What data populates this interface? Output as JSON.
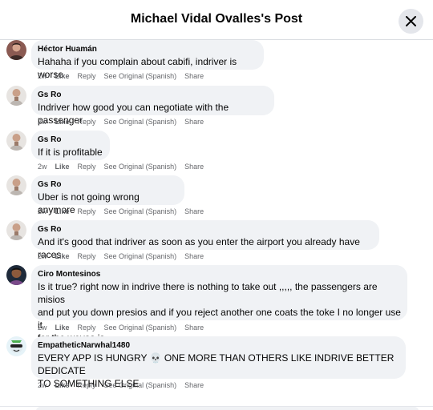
{
  "dialog": {
    "title": "Michael Vidal Ovalles's Post"
  },
  "labels": {
    "like": "Like",
    "reply": "Reply",
    "see_original": "See Original (Spanish)",
    "share": "Share"
  },
  "comments": [
    {
      "author": "Héctor Huamán",
      "text": "Hahaha if you complain about cabifi, indriver is worse",
      "time": "2w"
    },
    {
      "author": "Gs Ro",
      "text": "Indriver how good you can negotiate with the passenger",
      "time": "2w"
    },
    {
      "author": "Gs Ro",
      "text": "If it is profitable",
      "time": "2w"
    },
    {
      "author": "Gs Ro",
      "text": "Uber is not going wrong anymore",
      "time": "2w"
    },
    {
      "author": "Gs Ro",
      "text": "And it's good that indriver as soon as you enter the airport you already have races",
      "time": "2w"
    },
    {
      "author": "Ciro Montesinos",
      "text_lines": [
        "Is it true? right now in indrive there is nothing to take out ,,,,, the passengers are misios",
        "and put you down presios and if you reject another one coats the toke I no longer use it",
        "for the wevas is"
      ],
      "time": "2w"
    },
    {
      "author": "EmpatheticNarwhal1480",
      "text_lines": [
        "EVERY APP IS HUNGRY 💀 ONE MORE THAN OTHERS LIKE INDRIVE BETTER DEDICATE",
        "TO SOMETHING ELSE"
      ],
      "time": "2w"
    }
  ],
  "colors": {
    "bubble": "#f0f2f5",
    "meta": "#65676b",
    "text": "#050505"
  }
}
